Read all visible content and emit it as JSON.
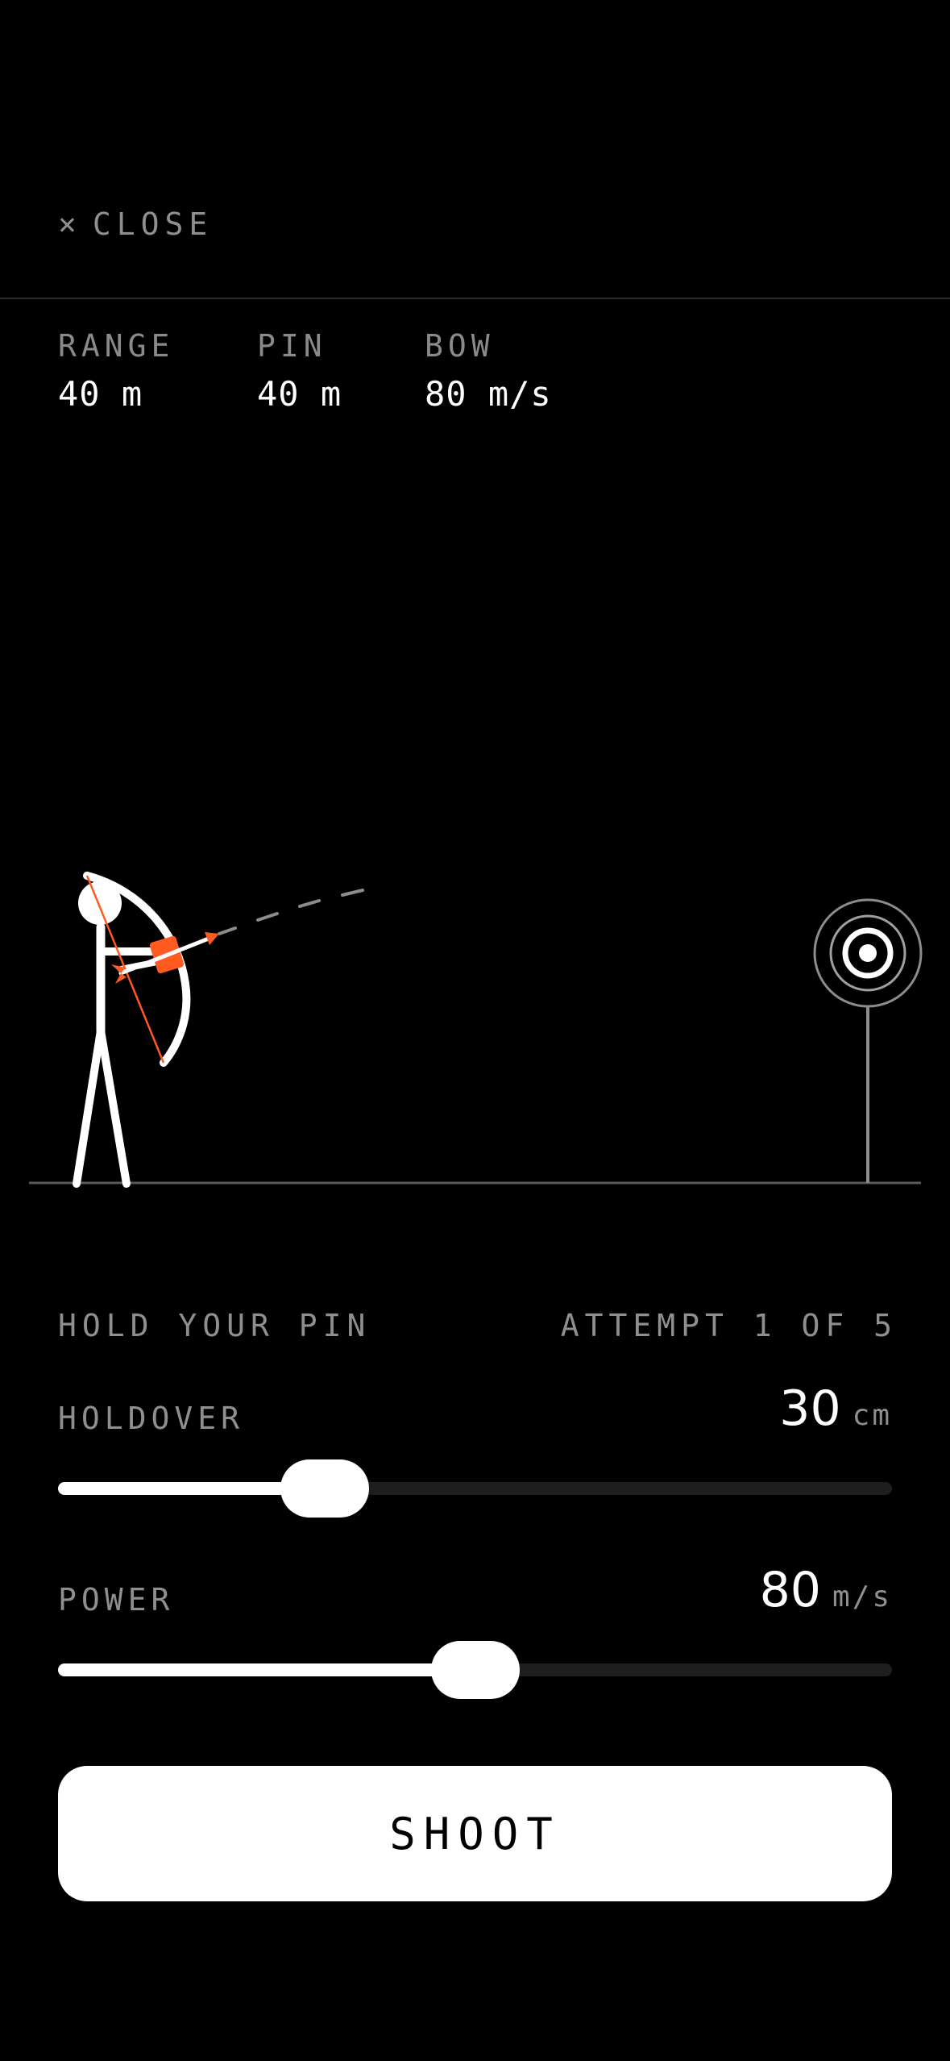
{
  "header": {
    "close_icon": "×",
    "close_label": "CLOSE"
  },
  "stats": {
    "range": {
      "label": "RANGE",
      "value": "40 m"
    },
    "pin": {
      "label": "PIN",
      "value": "40 m"
    },
    "bow": {
      "label": "BOW",
      "value": "80 m/s"
    }
  },
  "scene": {
    "icons": [
      "archer-figure",
      "bow-icon",
      "arrow-icon",
      "target-icon"
    ],
    "accent_color": "#ff5a1f"
  },
  "status": {
    "instruction": "HOLD YOUR PIN",
    "attempt": "ATTEMPT 1 OF 5",
    "attempt_current": 1,
    "attempt_total": 5
  },
  "holdover": {
    "label": "HOLDOVER",
    "value": "30",
    "unit": "cm",
    "level": 0.32
  },
  "power": {
    "label": "POWER",
    "value": "80",
    "unit": "m/s",
    "level": 0.5
  },
  "shoot_label": "SHOOT"
}
